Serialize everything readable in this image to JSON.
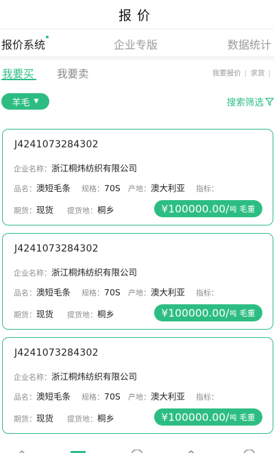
{
  "header": {
    "title": "报价"
  },
  "top_tabs": [
    {
      "label": "报价系统",
      "active": true
    },
    {
      "label": "企业专版",
      "active": false
    },
    {
      "label": "数据统计",
      "active": false
    }
  ],
  "sub_tabs": [
    {
      "label": "我要买",
      "active": true
    },
    {
      "label": "我要卖",
      "active": false
    }
  ],
  "right_links": {
    "my_quote": "我要报价",
    "want": "求货"
  },
  "filter": {
    "category": "羊毛",
    "search_filter": "搜索筛选"
  },
  "labels": {
    "company": "企业名称：",
    "product": "品名：",
    "spec": "规格：",
    "origin": "产地：",
    "indicator": "指标：",
    "futures": "期货：",
    "pickup": "提货地："
  },
  "cards": [
    {
      "code": "J4241073284302",
      "company": "浙江桐炜纺织有限公司",
      "product": "澳短毛条",
      "spec": "70S",
      "origin": "澳大利亚",
      "indicator": "",
      "futures": "现货",
      "pickup": "桐乡",
      "price": "¥100000.00/",
      "unit": "吨",
      "weight": "毛重"
    },
    {
      "code": "J4241073284302",
      "company": "浙江桐炜纺织有限公司",
      "product": "澳短毛条",
      "spec": "70S",
      "origin": "澳大利亚",
      "indicator": "",
      "futures": "现货",
      "pickup": "桐乡",
      "price": "¥100000.00/",
      "unit": "吨",
      "weight": "毛重"
    },
    {
      "code": "J4241073284302",
      "company": "浙江桐炜纺织有限公司",
      "product": "澳短毛条",
      "spec": "70S",
      "origin": "澳大利亚",
      "indicator": "",
      "futures": "现货",
      "pickup": "桐乡",
      "price": "¥100000.00/",
      "unit": "吨",
      "weight": "毛重"
    }
  ],
  "colors": {
    "accent": "#2dbd83",
    "label_grey": "#8c8c8c",
    "inactive_tab": "#9a9a9a"
  },
  "icons": [
    "filter-icon",
    "caret-down-icon",
    "nav-icons"
  ]
}
